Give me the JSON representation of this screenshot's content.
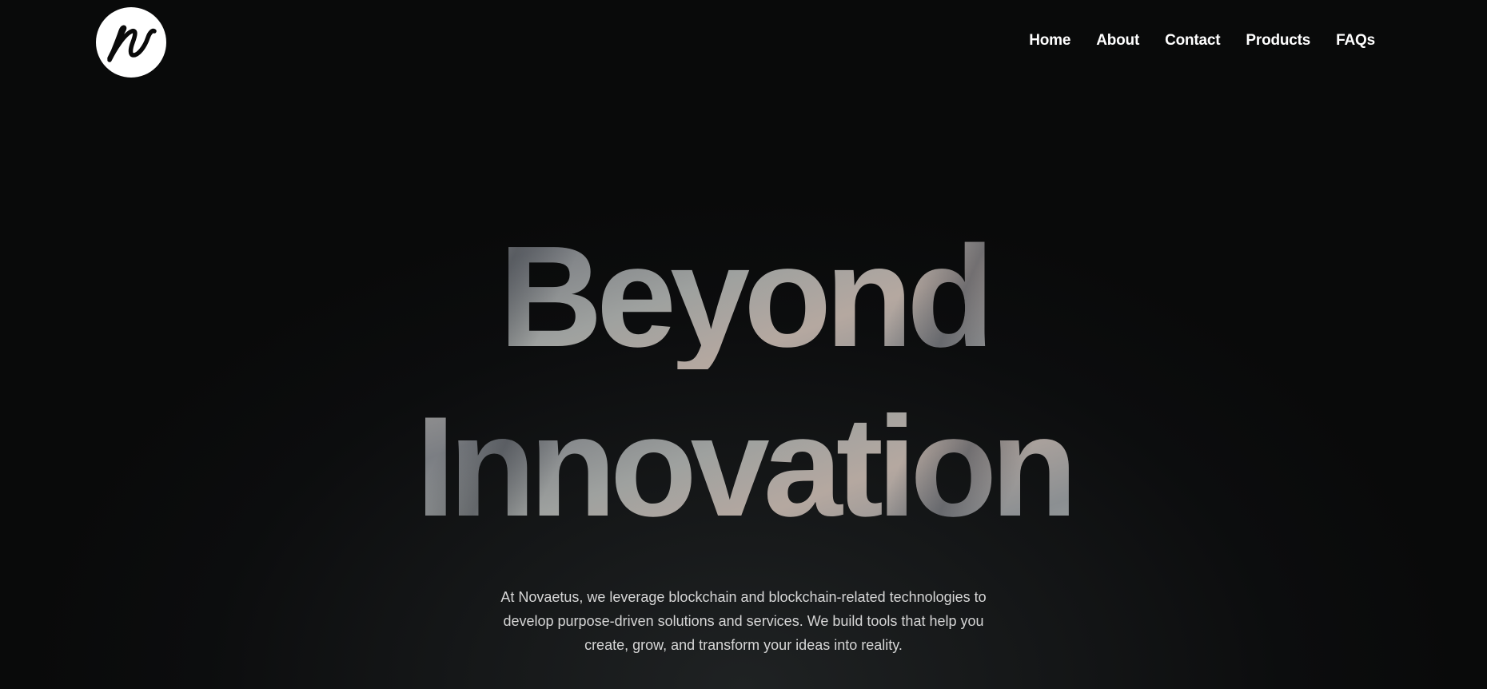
{
  "header": {
    "logo_icon": "cursive-n-logo-icon",
    "nav": [
      "Home",
      "About",
      "Contact",
      "Products",
      "FAQs"
    ]
  },
  "hero": {
    "title_line1": "Beyond",
    "title_line2": "Innovation",
    "description_line1": "At Novaetus, we leverage blockchain and blockchain-related technologies to",
    "description_line2": "develop purpose-driven solutions and services. We build tools that help you",
    "description_line3": "create, grow, and transform your ideas into reality."
  },
  "colors": {
    "background": "#0a0b0b",
    "text": "#ffffff",
    "description": "#d6d6d6"
  }
}
